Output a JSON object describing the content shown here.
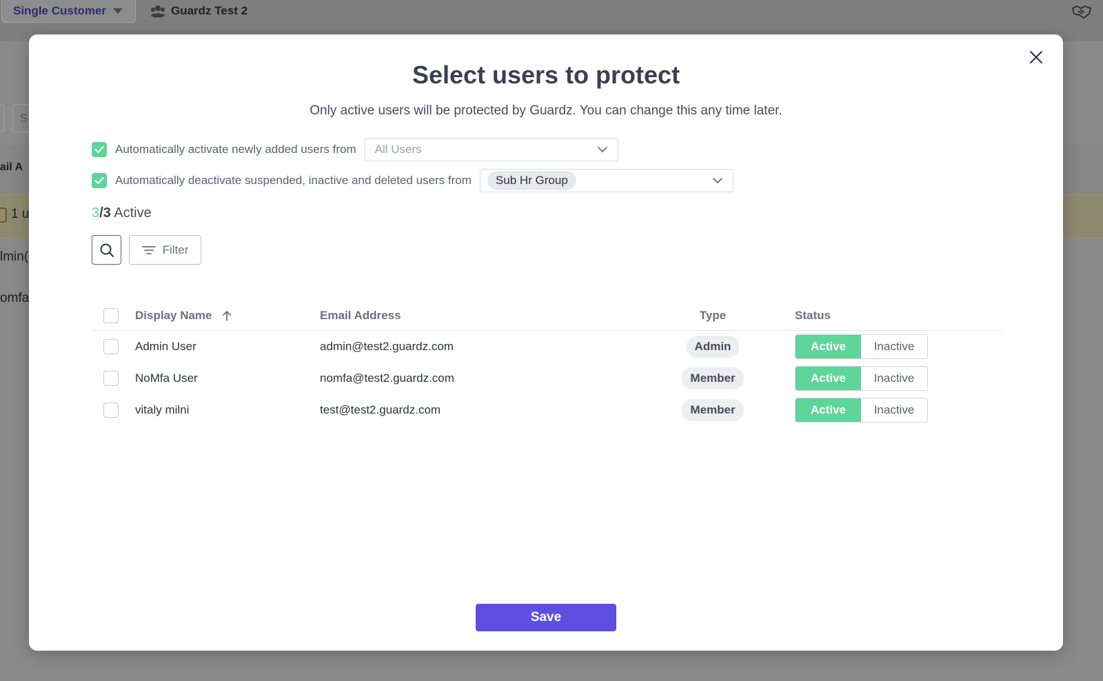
{
  "background": {
    "customer_selector": "Single Customer",
    "org_name": "Guardz Test 2",
    "fragments": {
      "search_frag": "S",
      "col_frag": "ail A",
      "alert_frag": "1 u",
      "row1_frag": "lmin(",
      "row2_frag": "omfa("
    }
  },
  "modal": {
    "title": "Select users to protect",
    "subtitle": "Only active users will be protected by Guardz. You can change this any time later.",
    "options": {
      "auto_activate_label": "Automatically activate newly added users from",
      "auto_activate_value": "All Users",
      "auto_deactivate_label": "Automatically deactivate suspended, inactive and deleted users from",
      "auto_deactivate_value": "Sub Hr Group"
    },
    "count": {
      "active": "3",
      "total": "/3",
      "suffix": " Active"
    },
    "filter_label": "Filter",
    "table": {
      "headers": {
        "name": "Display Name",
        "email": "Email Address",
        "type": "Type",
        "status": "Status"
      },
      "rows": [
        {
          "name": "Admin User",
          "email": "admin@test2.guardz.com",
          "type": "Admin",
          "active_label": "Active",
          "inactive_label": "Inactive"
        },
        {
          "name": "NoMfa User",
          "email": "nomfa@test2.guardz.com",
          "type": "Member",
          "active_label": "Active",
          "inactive_label": "Inactive"
        },
        {
          "name": "vitaly milni",
          "email": "test@test2.guardz.com",
          "type": "Member",
          "active_label": "Active",
          "inactive_label": "Inactive"
        }
      ]
    },
    "save_label": "Save"
  },
  "colors": {
    "accent": "#5e4ee2",
    "active_green": "#5ed69a",
    "text_dark": "#3b3f52"
  }
}
